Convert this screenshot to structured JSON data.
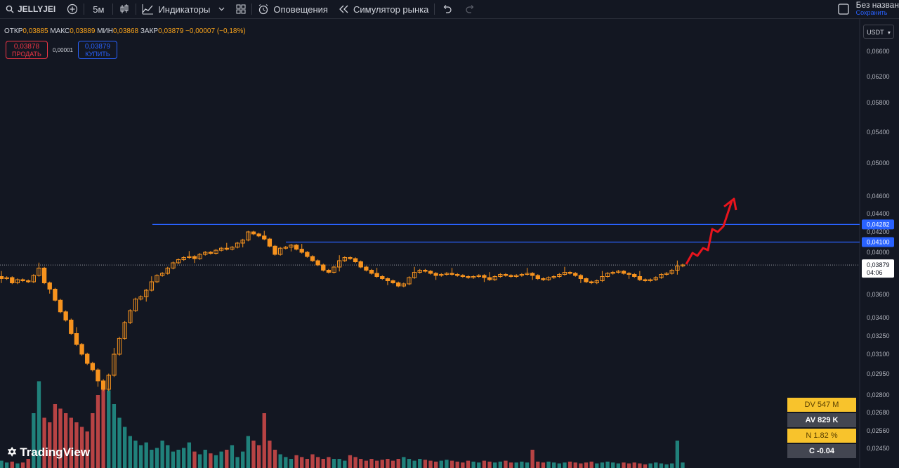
{
  "toolbar": {
    "symbol": "JELLYJEI",
    "interval": "5м",
    "indicators": "Индикаторы",
    "alerts": "Оповещения",
    "replay": "Симулятор рынка",
    "layout_title": "Без назван",
    "layout_status": "Сохранить"
  },
  "ohlc": {
    "open_label": "ОТКР",
    "open": "0,03885",
    "high_label": "МАКС",
    "high": "0,03889",
    "low_label": "МИН",
    "low": "0,03868",
    "close_label": "ЗАКР",
    "close": "0,03879",
    "change": "−0,00007 (−0,18%)"
  },
  "trade": {
    "sell_price": "0,03878",
    "sell_label": "ПРОДАТЬ",
    "spread": "0,00001",
    "buy_price": "0,03879",
    "buy_label": "КУПИТЬ"
  },
  "currency": "USDT",
  "axis": {
    "ticks": [
      "0,06600",
      "0,06200",
      "0,05800",
      "0,05400",
      "0,05000",
      "0,04600",
      "0,04400",
      "0,04200",
      "0,04000",
      "0,03600",
      "0,03400",
      "0,03250",
      "0,03100",
      "0,02950",
      "0,02800",
      "0,02680",
      "0,02560",
      "0,02450"
    ],
    "level_a": "0,04282",
    "level_b": "0,04100",
    "last_price": "0,03879",
    "countdown": "04:06"
  },
  "stats": {
    "dv": "DV 547 M",
    "av": "AV 829 K",
    "n": "N 1.82 %",
    "c": "C  -0.04"
  },
  "brand": "TradingView",
  "colors": {
    "background": "#131722",
    "candle": "#f7931e",
    "level_line": "#2962ff",
    "forecast_arrow": "#e8141d",
    "volume_up": "#26a69a",
    "volume_down": "#ef5350"
  },
  "chart_data": {
    "type": "candlestick",
    "price_axis": [
      "0,06600",
      "0,06200",
      "0,05800",
      "0,05400",
      "0,05000",
      "0,04600",
      "0,04400",
      "0,04200",
      "0,04000",
      "0,03600",
      "0,03400",
      "0,03250",
      "0,03100",
      "0,02950",
      "0,02800",
      "0,02680",
      "0,02560",
      "0,02450"
    ],
    "horizontal_levels": [
      0.04282,
      0.041
    ],
    "last_price": 0.03879,
    "close_series": [
      0.0375,
      0.0376,
      0.0371,
      0.0374,
      0.0373,
      0.0372,
      0.0378,
      0.0385,
      0.0371,
      0.0365,
      0.0355,
      0.0345,
      0.0338,
      0.0327,
      0.0318,
      0.031,
      0.0303,
      0.0298,
      0.029,
      0.0284,
      0.0294,
      0.031,
      0.0323,
      0.0336,
      0.0346,
      0.0356,
      0.0358,
      0.0364,
      0.0372,
      0.0378,
      0.038,
      0.0385,
      0.039,
      0.0393,
      0.0395,
      0.0396,
      0.0394,
      0.0398,
      0.04,
      0.0399,
      0.0402,
      0.0404,
      0.0403,
      0.0405,
      0.0409,
      0.0412,
      0.042,
      0.0418,
      0.0416,
      0.0413,
      0.0406,
      0.0398,
      0.0404,
      0.0405,
      0.0407,
      0.0403,
      0.04,
      0.0396,
      0.0392,
      0.0388,
      0.0383,
      0.0381,
      0.0386,
      0.0392,
      0.0395,
      0.0394,
      0.0391,
      0.0386,
      0.0383,
      0.038,
      0.0377,
      0.0375,
      0.0373,
      0.0371,
      0.0368,
      0.037,
      0.0376,
      0.0381,
      0.0383,
      0.0382,
      0.038,
      0.0378,
      0.0379,
      0.038,
      0.0379,
      0.0378,
      0.0377,
      0.0376,
      0.0377,
      0.0378,
      0.0376,
      0.0374,
      0.0377,
      0.0379,
      0.0378,
      0.0377,
      0.0378,
      0.0379,
      0.038,
      0.0378,
      0.0375,
      0.0374,
      0.0376,
      0.0377,
      0.0379,
      0.0381,
      0.038,
      0.0378,
      0.0375,
      0.0372,
      0.0371,
      0.0373,
      0.0377,
      0.038,
      0.0381,
      0.0382,
      0.038,
      0.0379,
      0.0377,
      0.0374,
      0.0373,
      0.0374,
      0.0376,
      0.0379,
      0.038,
      0.0383,
      0.0387,
      0.0388
    ],
    "volume_series": [
      0.08,
      0.06,
      0.07,
      0.05,
      0.06,
      0.1,
      0.6,
      0.95,
      0.55,
      0.5,
      0.7,
      0.65,
      0.6,
      0.55,
      0.5,
      0.45,
      0.4,
      0.6,
      0.8,
      0.92,
      0.85,
      0.7,
      0.55,
      0.45,
      0.35,
      0.3,
      0.25,
      0.28,
      0.2,
      0.22,
      0.3,
      0.25,
      0.18,
      0.2,
      0.22,
      0.28,
      0.18,
      0.15,
      0.2,
      0.16,
      0.14,
      0.18,
      0.2,
      0.25,
      0.12,
      0.18,
      0.35,
      0.3,
      0.25,
      0.6,
      0.3,
      0.2,
      0.15,
      0.12,
      0.1,
      0.14,
      0.12,
      0.1,
      0.15,
      0.12,
      0.1,
      0.12,
      0.1,
      0.1,
      0.08,
      0.14,
      0.12,
      0.1,
      0.08,
      0.1,
      0.08,
      0.09,
      0.1,
      0.08,
      0.1,
      0.12,
      0.1,
      0.08,
      0.1,
      0.09,
      0.08,
      0.07,
      0.08,
      0.09,
      0.08,
      0.07,
      0.06,
      0.08,
      0.07,
      0.06,
      0.08,
      0.07,
      0.06,
      0.07,
      0.08,
      0.06,
      0.06,
      0.07,
      0.06,
      0.2,
      0.07,
      0.06,
      0.07,
      0.06,
      0.05,
      0.06,
      0.07,
      0.06,
      0.05,
      0.06,
      0.07,
      0.05,
      0.06,
      0.07,
      0.06,
      0.05,
      0.06,
      0.05,
      0.06,
      0.05,
      0.04,
      0.05,
      0.06,
      0.05,
      0.04,
      0.05,
      0.3,
      0.06
    ]
  }
}
